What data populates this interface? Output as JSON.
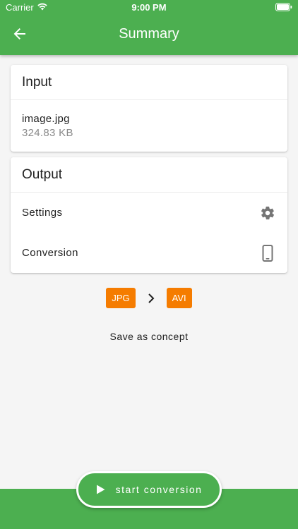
{
  "status_bar": {
    "carrier": "Carrier",
    "time": "9:00 PM"
  },
  "app_bar": {
    "title": "Summary",
    "back_icon": "arrow-back-icon"
  },
  "input_card": {
    "title": "Input",
    "file_name": "image.jpg",
    "file_size": "324.83 KB"
  },
  "output_card": {
    "title": "Output",
    "settings_label": "Settings",
    "settings_icon": "gear-icon",
    "conversion_label": "Conversion",
    "conversion_icon": "phone-icon"
  },
  "formats": {
    "from": "JPG",
    "to": "AVI"
  },
  "save_concept_label": "Save as concept",
  "fab": {
    "label": "start conversion",
    "icon": "play-icon"
  },
  "colors": {
    "primary": "#4caf50",
    "accent": "#f57c00",
    "background": "#f5f5f5"
  }
}
